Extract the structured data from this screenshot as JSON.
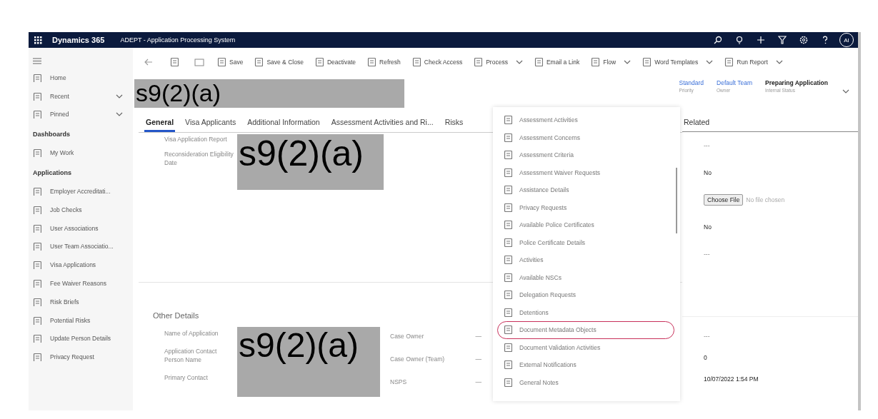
{
  "top_bar": {
    "app_name": "Dynamics 365",
    "app_title": "ADEPT - Application Processing System",
    "user_initials": "AI"
  },
  "sidebar": {
    "top_items": [
      {
        "label": "Home",
        "expandable": false
      },
      {
        "label": "Recent",
        "expandable": true
      },
      {
        "label": "Pinned",
        "expandable": true
      }
    ],
    "groups": [
      {
        "title": "Dashboards",
        "items": [
          "My Work"
        ]
      },
      {
        "title": "Applications",
        "items": [
          "Employer Accreditati...",
          "Job Checks",
          "User Associations",
          "User Team Associatio...",
          "Visa Applications",
          "Fee Waiver Reasons",
          "Risk Briefs",
          "Potential Risks",
          "Update Person Details",
          "Privacy Request"
        ]
      }
    ]
  },
  "command_bar": {
    "items": [
      {
        "label": "Save",
        "dropdown": false
      },
      {
        "label": "Save & Close",
        "dropdown": false
      },
      {
        "label": "Deactivate",
        "dropdown": false
      },
      {
        "label": "Refresh",
        "dropdown": false
      },
      {
        "label": "Check Access",
        "dropdown": false
      },
      {
        "label": "Process",
        "dropdown": true
      },
      {
        "label": "Email a Link",
        "dropdown": false
      },
      {
        "label": "Flow",
        "dropdown": true
      },
      {
        "label": "Word Templates",
        "dropdown": true
      },
      {
        "label": "Run Report",
        "dropdown": true
      }
    ]
  },
  "record_header": {
    "title_redaction": "s9(2)(a)",
    "fields": [
      {
        "value": "Standard",
        "label": "Priority",
        "kind": "link"
      },
      {
        "value": "Default Team",
        "label": "Owner",
        "kind": "link"
      },
      {
        "value": "Preparing Application",
        "label": "Internal Status",
        "kind": "text"
      }
    ]
  },
  "tabs": [
    {
      "label": "General",
      "selected": true
    },
    {
      "label": "Visa Applicants",
      "selected": false
    },
    {
      "label": "Additional Information",
      "selected": false
    },
    {
      "label": "Assessment Activities and Ri...",
      "selected": false
    },
    {
      "label": "Risks",
      "selected": false
    }
  ],
  "form": {
    "section_1": {
      "labels": [
        "Visa Application Report",
        "Reconsideration Eligibility Date"
      ],
      "redaction": "s9(2)(a)"
    },
    "other_details": {
      "title": "Other Details",
      "labels": [
        "Name of Application",
        "Application Contact Person Name",
        "Primary Contact"
      ],
      "redaction": "s9(2)(a)",
      "right_fields": [
        {
          "label": "Case Owner",
          "value": "—"
        },
        {
          "label": "Case Owner (Team)",
          "value": "—"
        },
        {
          "label": "NSPS",
          "value": "—"
        }
      ]
    }
  },
  "related_menu": {
    "items": [
      {
        "label": "Assessment Activities",
        "circled": false
      },
      {
        "label": "Assessment Concerns",
        "circled": false
      },
      {
        "label": "Assessment Criteria",
        "circled": false
      },
      {
        "label": "Assessment Waiver Requests",
        "circled": false
      },
      {
        "label": "Assistance Details",
        "circled": false
      },
      {
        "label": "Privacy Requests",
        "circled": false
      },
      {
        "label": "Available Police Certificates",
        "circled": false
      },
      {
        "label": "Police Certificate Details",
        "circled": false
      },
      {
        "label": "Activities",
        "circled": false
      },
      {
        "label": "Available NSCs",
        "circled": false
      },
      {
        "label": "Delegation Requests",
        "circled": false
      },
      {
        "label": "Detentions",
        "circled": false
      },
      {
        "label": "Document Metadata Objects",
        "circled": true
      },
      {
        "label": "Document Validation Activities",
        "circled": false
      },
      {
        "label": "External Notifications",
        "circled": false
      },
      {
        "label": "General Notes",
        "circled": false
      }
    ]
  },
  "related_panel": {
    "title": "Related",
    "values_top": [
      {
        "kind": "empty",
        "value": "---"
      },
      {
        "kind": "text",
        "value": "No"
      },
      {
        "kind": "file",
        "button": "Choose File",
        "status": "No file chosen"
      },
      {
        "kind": "text",
        "value": "No"
      },
      {
        "kind": "empty",
        "value": "---"
      }
    ],
    "values_bottom": [
      {
        "kind": "empty",
        "value": "---"
      },
      {
        "kind": "text",
        "value": "0"
      },
      {
        "kind": "text",
        "value": "10/07/2022 1:54 PM"
      }
    ]
  }
}
